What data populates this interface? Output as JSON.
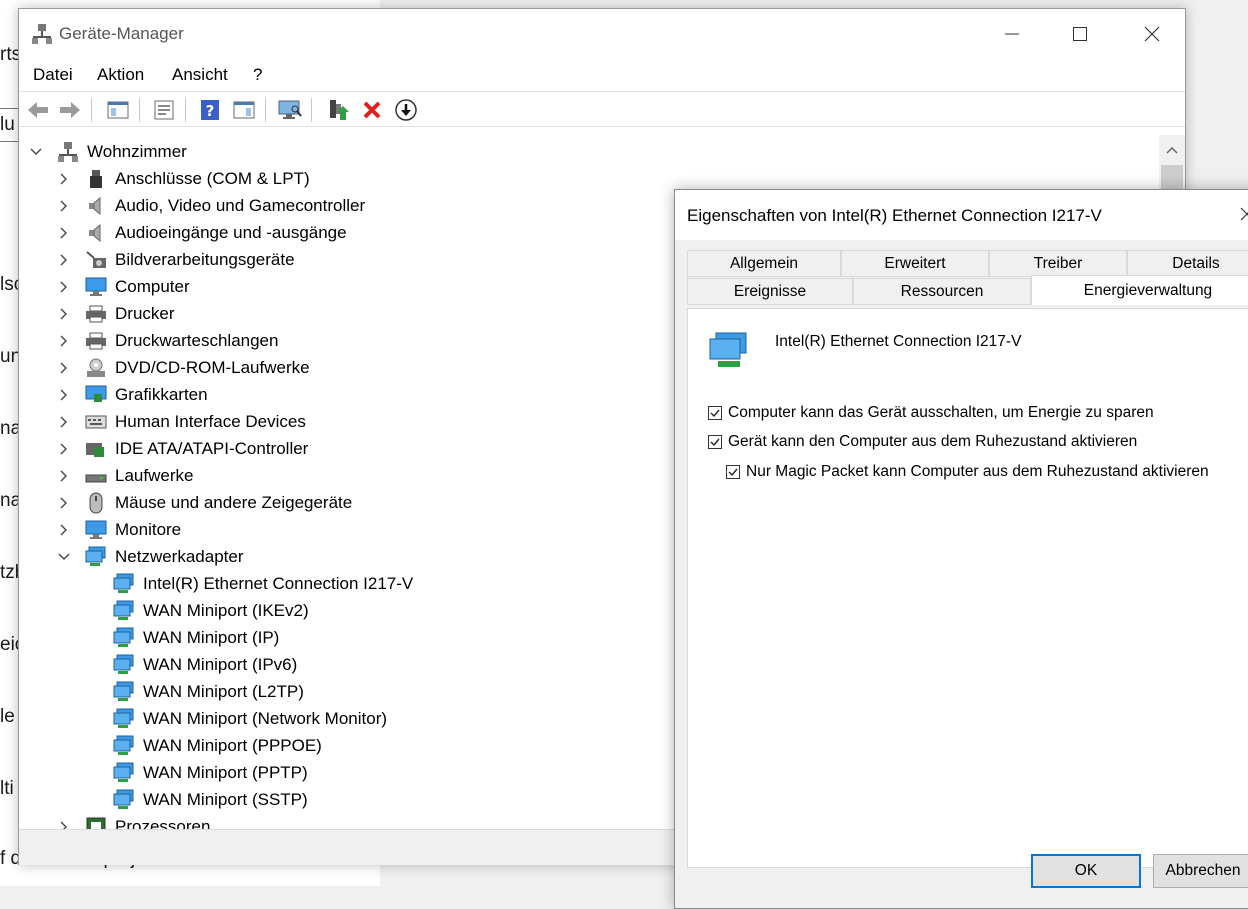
{
  "background": {
    "fragments": [
      "rts",
      "lu",
      "lsc",
      "un",
      "nac",
      "nac",
      "tzb",
      "eic",
      "le",
      "lti"
    ],
    "bottom_text": "f diesen PC projizieren"
  },
  "device_manager": {
    "title": "Geräte-Manager",
    "menu": [
      "Datei",
      "Aktion",
      "Ansicht",
      "?"
    ],
    "toolbar_icons": [
      "back-icon",
      "forward-icon",
      "show-hide-console-tree-icon",
      "properties-icon",
      "help-icon",
      "action-pane-icon",
      "scan-hardware-icon",
      "update-driver-icon",
      "uninstall-icon",
      "disable-icon"
    ],
    "tree": {
      "root": "Wohnzimmer",
      "categories": [
        {
          "label": "Anschlüsse (COM & LPT)",
          "icon": "port-icon"
        },
        {
          "label": "Audio, Video und Gamecontroller",
          "icon": "speaker-icon"
        },
        {
          "label": "Audioeingänge und -ausgänge",
          "icon": "speaker-icon"
        },
        {
          "label": "Bildverarbeitungsgeräte",
          "icon": "camera-icon"
        },
        {
          "label": "Computer",
          "icon": "computer-icon"
        },
        {
          "label": "Drucker",
          "icon": "printer-icon"
        },
        {
          "label": "Druckwarteschlangen",
          "icon": "printer-icon"
        },
        {
          "label": "DVD/CD-ROM-Laufwerke",
          "icon": "dvd-icon"
        },
        {
          "label": "Grafikkarten",
          "icon": "display-adapter-icon"
        },
        {
          "label": "Human Interface Devices",
          "icon": "hid-icon"
        },
        {
          "label": "IDE ATA/ATAPI-Controller",
          "icon": "ide-controller-icon"
        },
        {
          "label": "Laufwerke",
          "icon": "drive-icon"
        },
        {
          "label": "Mäuse und andere Zeigegeräte",
          "icon": "mouse-icon"
        },
        {
          "label": "Monitore",
          "icon": "monitor-icon"
        },
        {
          "label": "Netzwerkadapter",
          "icon": "network-adapter-icon"
        }
      ],
      "network_adapters": [
        "Intel(R) Ethernet Connection I217-V",
        "WAN Miniport (IKEv2)",
        "WAN Miniport (IP)",
        "WAN Miniport (IPv6)",
        "WAN Miniport (L2TP)",
        "WAN Miniport (Network Monitor)",
        "WAN Miniport (PPPOE)",
        "WAN Miniport (PPTP)",
        "WAN Miniport (SSTP)"
      ],
      "after": "Prozessoren"
    }
  },
  "dialog": {
    "title": "Eigenschaften von Intel(R) Ethernet Connection I217-V",
    "tabs_row1": [
      "Allgemein",
      "Erweitert",
      "Treiber",
      "Details"
    ],
    "tabs_row2": [
      "Ereignisse",
      "Ressourcen",
      "Energieverwaltung"
    ],
    "active_tab": "Energieverwaltung",
    "device_name": "Intel(R) Ethernet Connection I217-V",
    "options": [
      {
        "label": "Computer kann das Gerät ausschalten, um Energie zu sparen",
        "checked": true
      },
      {
        "label": "Gerät kann den Computer aus dem Ruhezustand aktivieren",
        "checked": true
      },
      {
        "label": "Nur Magic Packet kann Computer aus dem Ruhezustand aktivieren",
        "checked": true
      }
    ],
    "ok_label": "OK",
    "cancel_label": "Abbrechen"
  },
  "colors": {
    "accent": "#0078d7",
    "window_bg": "#ffffff",
    "dialog_bg": "#f0f0f0"
  }
}
